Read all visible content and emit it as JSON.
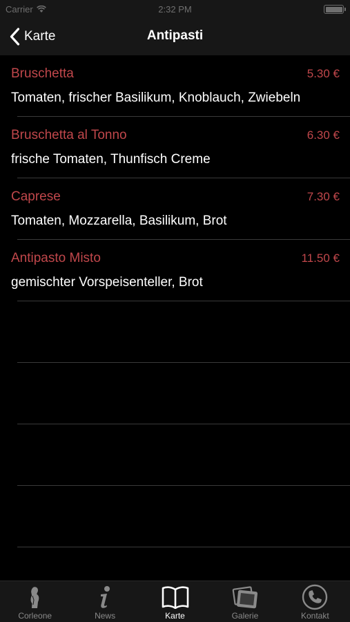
{
  "status_bar": {
    "carrier": "Carrier",
    "time": "2:32 PM"
  },
  "nav": {
    "back_label": "Karte",
    "title": "Antipasti"
  },
  "menu": {
    "items": [
      {
        "name": "Bruschetta",
        "price": "5.30 €",
        "description": "Tomaten, frischer Basilikum, Knoblauch, Zwiebeln"
      },
      {
        "name": "Bruschetta al Tonno",
        "price": "6.30 €",
        "description": "frische Tomaten, Thunfisch Creme"
      },
      {
        "name": "Caprese",
        "price": "7.30 €",
        "description": "Tomaten, Mozzarella, Basilikum, Brot"
      },
      {
        "name": "Antipasto Misto",
        "price": "11.50 €",
        "description": "gemischter Vorspeisenteller, Brot"
      }
    ]
  },
  "tab_bar": {
    "tabs": [
      {
        "label": "Corleone",
        "icon": "person-silhouette-icon"
      },
      {
        "label": "News",
        "icon": "info-icon"
      },
      {
        "label": "Karte",
        "icon": "open-book-icon",
        "active": true
      },
      {
        "label": "Galerie",
        "icon": "photos-icon"
      },
      {
        "label": "Kontakt",
        "icon": "phone-icon"
      }
    ]
  },
  "colors": {
    "accent": "#c0474b",
    "background": "#000000",
    "bar_background": "#171717",
    "inactive_tab": "#8a8a8a"
  }
}
